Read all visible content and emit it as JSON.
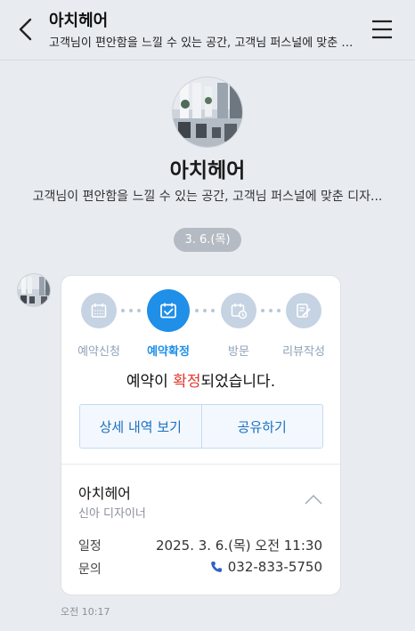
{
  "header": {
    "title": "아치헤어",
    "subtitle": "고객님이 편안함을 느낄 수 있는 공간, 고객님 퍼스널에 맞춘 디..."
  },
  "profile": {
    "name": "아치헤어",
    "description": "고객님이 편안함을 느낄 수 있는 공간, 고객님 퍼스널에 맞춘 디자..."
  },
  "date_divider": "3. 6.(목)",
  "steps": [
    {
      "label": "예약신청",
      "icon": "calendar-icon",
      "active": false
    },
    {
      "label": "예약확정",
      "icon": "calendar-check-icon",
      "active": true
    },
    {
      "label": "방문",
      "icon": "calendar-clock-icon",
      "active": false
    },
    {
      "label": "리뷰작성",
      "icon": "review-edit-icon",
      "active": false
    }
  ],
  "confirm": {
    "prefix": "예약이 ",
    "highlight": "확정",
    "suffix": "되었습니다."
  },
  "buttons": {
    "details": "상세 내역 보기",
    "share": "공유하기"
  },
  "booking": {
    "shop": "아치헤어",
    "designer": "신아 디자이너",
    "schedule_label": "일정",
    "schedule_value": "2025. 3. 6.(목) 오전 11:30",
    "contact_label": "문의",
    "contact_value": "032-833-5750"
  },
  "message_time": "오전 10:17",
  "colors": {
    "accent": "#1f8fe8",
    "highlight": "#e0382f",
    "background": "#e8ecf1"
  }
}
